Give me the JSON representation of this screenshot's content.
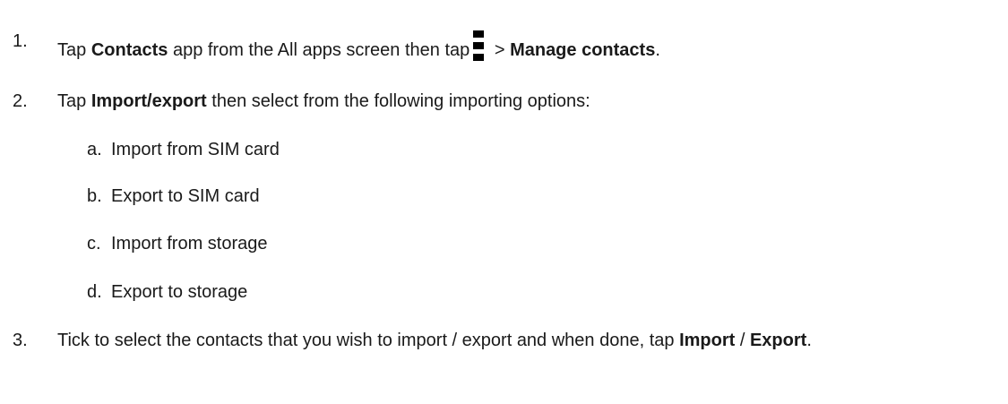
{
  "steps": [
    {
      "number": "1.",
      "a": "Tap ",
      "b": "Contacts",
      "c": " app from the All apps screen then tap",
      "d": " > ",
      "e": "Manage contacts",
      "f": ".",
      "icon": "more-options-icon"
    },
    {
      "number": "2.",
      "a": "Tap ",
      "b": "Import/export",
      "c": " then select from the following importing options:"
    },
    {
      "number": "3.",
      "a": "Tick to select the contacts that you wish to import / export and when done, tap ",
      "b": "Import",
      "c": " / ",
      "d": "Export",
      "e": "."
    }
  ],
  "options": [
    {
      "letter": "a.",
      "text": "Import from SIM card"
    },
    {
      "letter": "b.",
      "text": "Export to SIM card"
    },
    {
      "letter": "c.",
      "text": "Import from storage"
    },
    {
      "letter": "d.",
      "text": "Export to storage"
    }
  ]
}
